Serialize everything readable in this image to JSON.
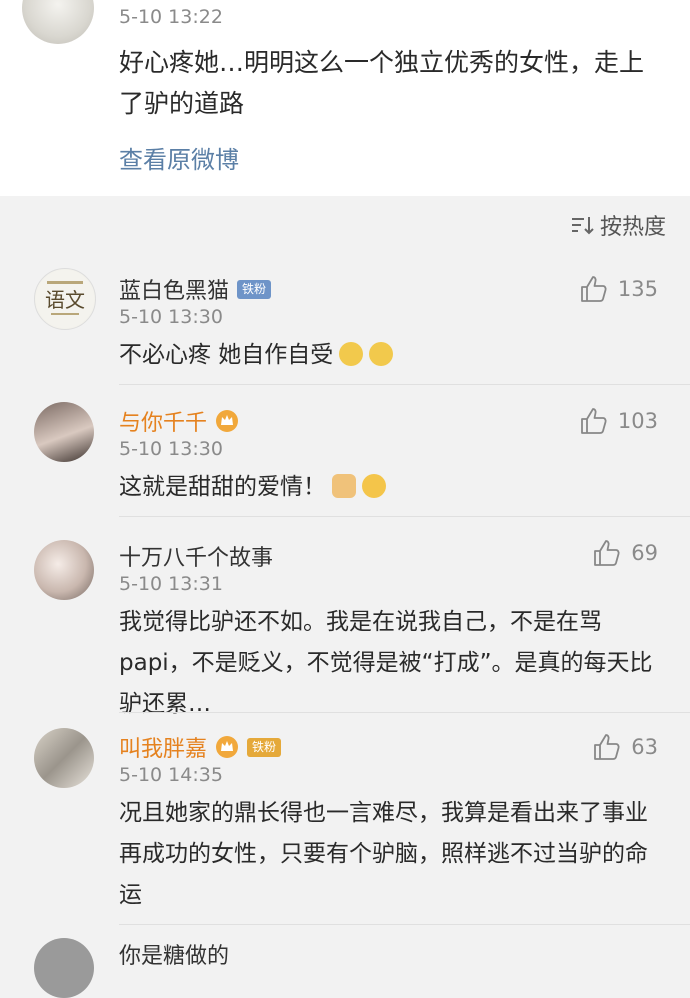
{
  "post": {
    "time": "5-10 13:22",
    "text": "好心疼她…明明这么一个独立优秀的女性，走上了驴的道路",
    "view_original": "查看原微博"
  },
  "sort": {
    "label": "按热度",
    "icon": "sort-icon"
  },
  "comments": [
    {
      "name": "蓝白色黑猫",
      "badge": "铁粉",
      "time": "5-10 13:30",
      "likes": "135",
      "text": "不必心疼 她自作自受"
    },
    {
      "name": "与你千千",
      "badge": "",
      "time": "5-10 13:30",
      "likes": "103",
      "text": "这就是甜甜的爱情！"
    },
    {
      "name": "十万八千个故事",
      "badge": "",
      "time": "5-10 13:31",
      "likes": "69",
      "text": "我觉得比驴还不如。我是在说我自己，不是在骂papi，不是贬义，不觉得是被“打成”。是真的每天比驴还累…"
    },
    {
      "name": "叫我胖嘉",
      "badge": "铁粉",
      "time": "5-10 14:35",
      "likes": "63",
      "text": "况且她家的鼎长得也一言难尽，我算是看出来了事业再成功的女性，只要有个驴脑，照样逃不过当驴的命运"
    },
    {
      "name": "你是糖做的",
      "badge": "",
      "time": "",
      "likes": "",
      "text": ""
    }
  ],
  "colors": {
    "vip_name": "#e5821f",
    "link": "#5b7fa6",
    "badge_blue": "#6e94c8"
  }
}
